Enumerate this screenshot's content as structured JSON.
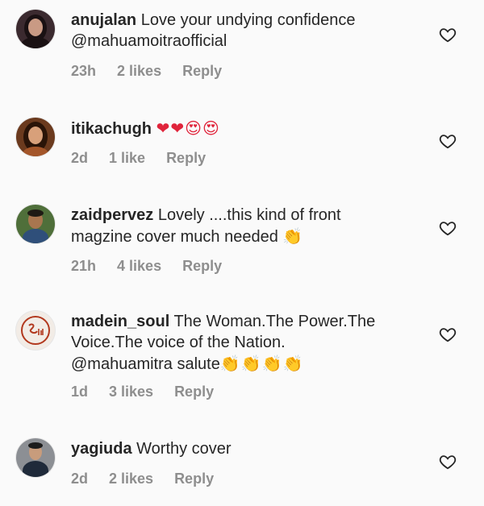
{
  "comments": [
    {
      "username": "anujalan",
      "text": "Love your undying confidence",
      "text2": "@mahuamoitraofficial",
      "time": "23h",
      "likes": "2 likes",
      "reply": "Reply",
      "avatar": {
        "bg": "#3b2a2f",
        "skin": "#c99a84",
        "hair": "#1a1113"
      }
    },
    {
      "username": "itikachugh",
      "emoji": "❤❤😍😍",
      "time": "2d",
      "likes": "1 like",
      "reply": "Reply",
      "avatar": {
        "bg": "#6b3a1e",
        "skin": "#d8a07a",
        "hair": "#2a1408"
      }
    },
    {
      "username": "zaidpervez",
      "text": "Lovely ....this kind of front",
      "text2": "magzine cover much needed",
      "emoji": "👏",
      "time": "21h",
      "likes": "4 likes",
      "reply": "Reply",
      "avatar": {
        "bg": "#4f6f3a",
        "skin": "#a8764f",
        "hair": "#1e1a14",
        "shirt": "#2f4f7a"
      }
    },
    {
      "username": "madein_soul",
      "text": "The Woman.The Power.The",
      "text2": "Voice.The voice of the Nation.",
      "text3": "@mahuamitra salute",
      "emoji": "👏👏👏👏",
      "time": "1d",
      "likes": "3 likes",
      "reply": "Reply",
      "avatar": {
        "bg": "#f2ece6",
        "logo": "#b2391f"
      }
    },
    {
      "username": "yagiuda",
      "text": "Worthy cover",
      "time": "2d",
      "likes": "2 likes",
      "reply": "Reply",
      "avatar": {
        "bg": "#8c8f94",
        "skin": "#c89c7c",
        "hair": "#1c1c1c",
        "shirt": "#1f2a3a"
      }
    }
  ],
  "colors": {
    "background": "#fafafa",
    "text": "#262626",
    "meta": "#8e8e8e"
  },
  "icons": {
    "like": "heart-outline-icon"
  }
}
